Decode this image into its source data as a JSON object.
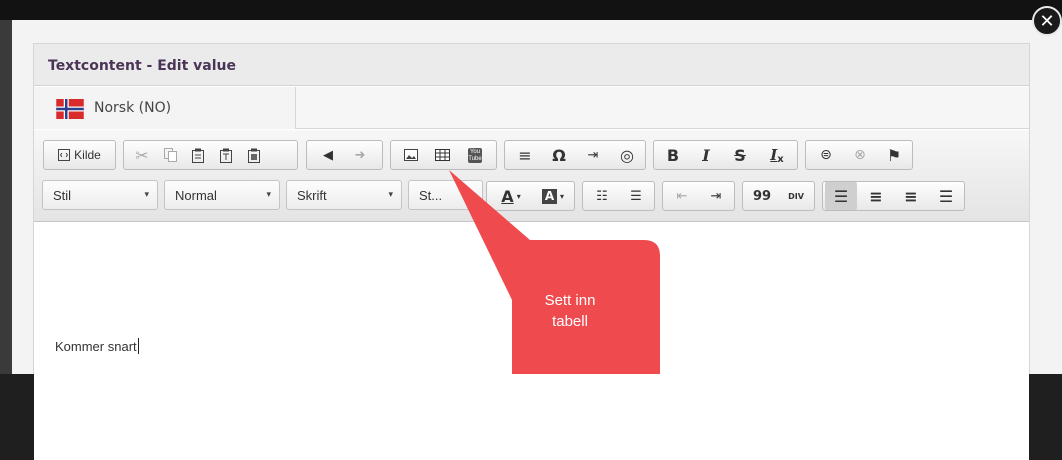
{
  "dialog": {
    "title": "Textcontent - Edit value",
    "close_symbol": "✕"
  },
  "language_tab": {
    "label": "Norsk (NO)",
    "flag_icon": "norway-flag-icon"
  },
  "toolbar": {
    "source_button_label": "Kilde",
    "row1_icons": [
      "source-icon",
      "cut-icon",
      "copy-icon",
      "paste-icon",
      "paste-text-icon",
      "paste-word-icon",
      "undo-icon",
      "redo-icon",
      "image-icon",
      "table-icon",
      "youtube-icon",
      "horizontal-line-icon",
      "special-char-icon",
      "indent-icon",
      "globe-icon",
      "bold-icon",
      "italic-icon",
      "strikethrough-icon",
      "remove-format-icon",
      "link-icon",
      "unlink-icon",
      "anchor-flag-icon"
    ],
    "row1_glyphs": {
      "bold": "B",
      "italic": "I",
      "strike": "S",
      "clear": "I",
      "omega": "Ω",
      "youtube": "You Tube",
      "div": "DIV"
    },
    "combos": [
      {
        "label": "Stil"
      },
      {
        "label": "Normal"
      },
      {
        "label": "Skrift"
      },
      {
        "label": "St..."
      }
    ],
    "combo_arrow": "▾",
    "row2_glyphs": {
      "text_color": "A",
      "bg_color": "A",
      "quote": "99"
    },
    "row2_icons": [
      "text-color-icon",
      "background-color-icon",
      "numbered-list-icon",
      "bullet-list-icon",
      "decrease-indent-icon",
      "increase-indent-icon",
      "blockquote-icon",
      "div-container-icon",
      "align-left-icon",
      "align-center-icon",
      "align-right-icon",
      "justify-icon"
    ]
  },
  "editor": {
    "content": "Kommer snart"
  },
  "tooltip": {
    "text_line1": "Sett inn",
    "text_line2": "tabell",
    "color": "#ef4b4f"
  },
  "colors": {
    "title": "#4a3556",
    "callout": "#ef4b4f",
    "flag_red": "#d92b2b",
    "flag_blue": "#2b3f8f"
  }
}
